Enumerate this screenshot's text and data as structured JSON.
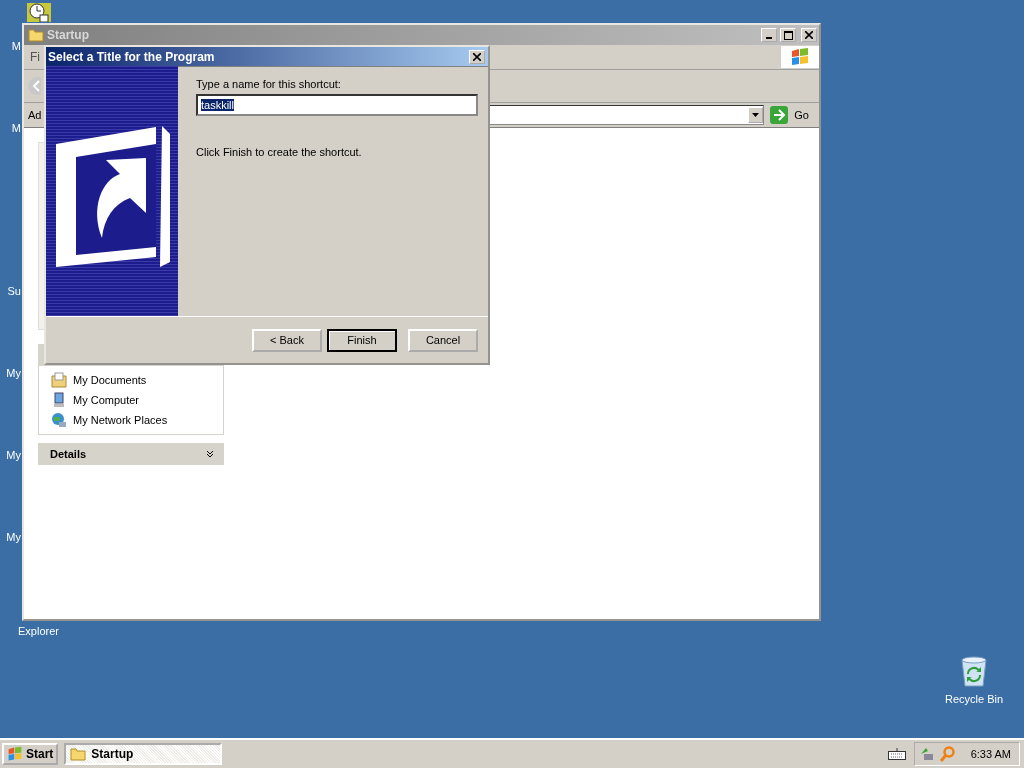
{
  "desktop": {
    "icons": [
      {
        "label": "M"
      },
      {
        "label": "M"
      },
      {
        "label": "Su"
      },
      {
        "label": "My"
      },
      {
        "label": "My"
      },
      {
        "label": "My"
      },
      {
        "label": "Explorer"
      }
    ],
    "recycle_bin": {
      "label": "Recycle Bin"
    }
  },
  "explorer": {
    "title": "Startup",
    "menu": [
      "Fi"
    ],
    "address_label": "Ad",
    "go_label": "Go",
    "places": [
      "My Documents",
      "My Computer",
      "My Network Places"
    ],
    "details_title": "Details"
  },
  "dialog": {
    "title": "Select a Title for the Program",
    "prompt": "Type a name for this shortcut:",
    "name_value": "taskkill",
    "name_selected": true,
    "hint": "Click Finish to create the shortcut.",
    "buttons": [
      {
        "label": "< Back",
        "default": false
      },
      {
        "label": "Finish",
        "default": true
      },
      {
        "label": "Cancel",
        "default": false
      }
    ]
  },
  "taskbar": {
    "start": "Start",
    "tasks": [
      {
        "label": "Startup",
        "selected": true
      }
    ],
    "clock": "6:33 AM"
  }
}
